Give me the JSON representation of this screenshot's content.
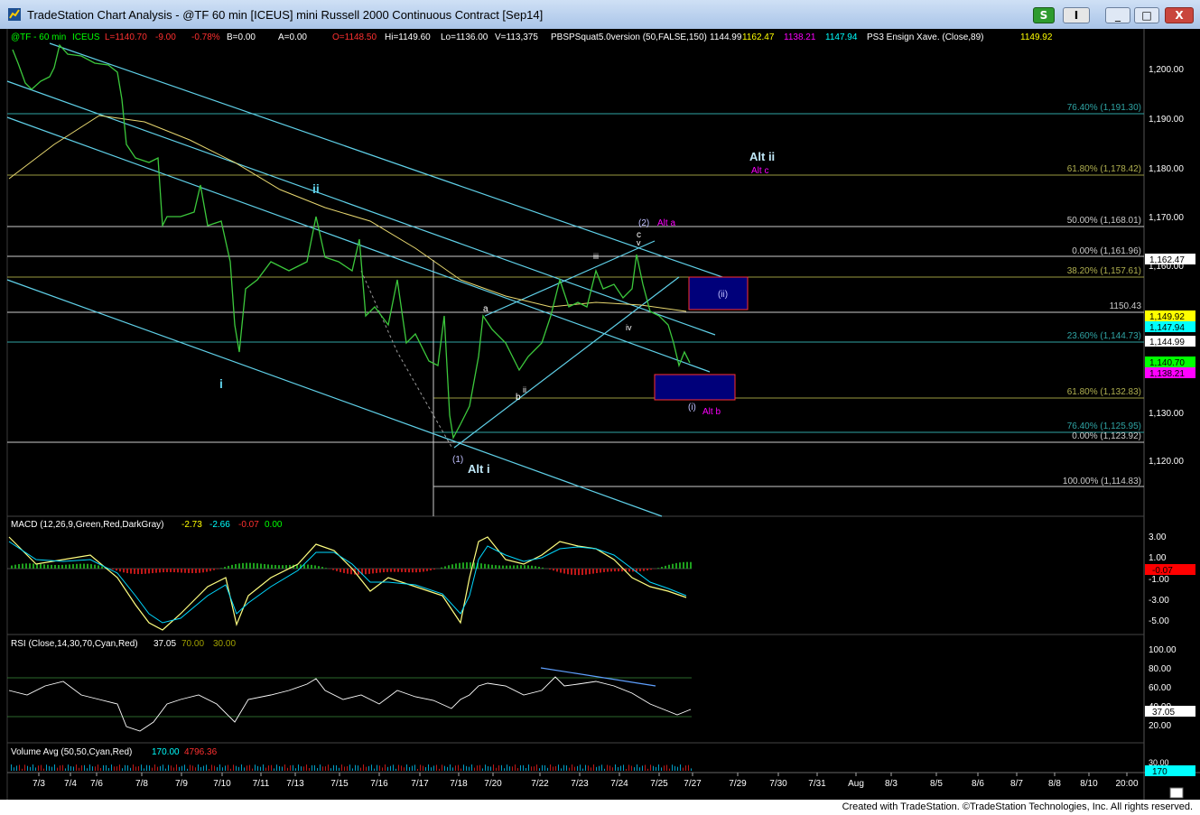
{
  "window": {
    "title": "TradeStation Chart Analysis - @TF 60 min [ICEUS] mini Russell 2000 Continuous Contract [Sep14]",
    "buttons": [
      "S",
      "I",
      "_",
      "□",
      "X"
    ]
  },
  "header": {
    "symbol": "@TF - 60 min",
    "exchange": "ICEUS",
    "last": "L=1140.70",
    "change": "-9.00",
    "pct": "-0.78%",
    "bid": "B=0.00",
    "ask": "A=0.00",
    "open": "O=1148.50",
    "hi": "Hi=1149.60",
    "lo": "Lo=1136.00",
    "vol": "V=113,375",
    "study": "PBSPSquat5.0version (50,FALSE,150)",
    "study_vals": [
      "1144.99",
      "1162.47",
      "1138.21",
      "1147.94"
    ],
    "ensign": "PS3 Ensign Xave. (Close,89)",
    "ensign_val": "1149.92"
  },
  "price_axis": {
    "ticks": [
      "1,200.00",
      "1,190.00",
      "1,180.00",
      "1,170.00",
      "1,160.00",
      "1,130.00",
      "1,120.00"
    ],
    "badges": [
      {
        "text": "1,162.47",
        "bg": "#ffffff",
        "fg": "#000000"
      },
      {
        "text": "1,149.92",
        "bg": "#ffff00",
        "fg": "#000000"
      },
      {
        "text": "1,147.94",
        "bg": "#00ffff",
        "fg": "#000000"
      },
      {
        "text": "1,144.99",
        "bg": "#ffffff",
        "fg": "#000000"
      },
      {
        "text": "1,140.70",
        "bg": "#00ff00",
        "fg": "#000000"
      },
      {
        "text": "1,138.21",
        "bg": "#ff00ff",
        "fg": "#000000"
      }
    ]
  },
  "fib_labels": [
    "76.40% (1,191.30)",
    "61.80% (1,178.42)",
    "50.00% (1,168.01)",
    "0.00% (1,161.96)",
    "38.20% (1,157.61)",
    "1150.43",
    "23.60% (1,144.73)",
    "61.80% (1,132.83)",
    "76.40% (1,125.95)",
    "0.00% (1,123.92)",
    "100.00% (1,114.83)"
  ],
  "annotations": {
    "i": "i",
    "ii": "ii",
    "alt_ii": "Alt ii",
    "alt_c": "Alt c",
    "two": "(2)",
    "alt_a": "Alt a",
    "c": "c",
    "v": "v",
    "iii": "iii",
    "a": "a",
    "iv": "iv",
    "b": "b",
    "ii_small": "ii",
    "box_ii": "(ii)",
    "box_i": "(i)",
    "alt_b": "Alt b",
    "one": "(1)",
    "alt_i": "Alt i"
  },
  "macd": {
    "label": "MACD (12,26,9,Green,Red,DarkGray)",
    "vals": [
      "-2.73",
      "-2.66",
      "-0.07",
      "0.00"
    ],
    "ticks": [
      "3.00",
      "1.00",
      "-1.00",
      "-3.00",
      "-5.00"
    ],
    "badge": "-0.07"
  },
  "rsi": {
    "label": "RSI (Close,14,30,70,Cyan,Red)",
    "vals": [
      "37.05",
      "70.00",
      "30.00"
    ],
    "ticks": [
      "100.00",
      "80.00",
      "60.00",
      "40.00",
      "20.00"
    ],
    "badge": "37.05"
  },
  "volume": {
    "label": "Volume Avg (50,50,Cyan,Red)",
    "vals": [
      "170.00",
      "4796.36"
    ],
    "badge": "170",
    "tick": "30.00"
  },
  "date_axis": [
    "7/3",
    "7/4",
    "7/6",
    "7/8",
    "7/9",
    "7/10",
    "7/11",
    "7/13",
    "7/15",
    "7/16",
    "7/17",
    "7/18",
    "7/20",
    "7/22",
    "7/23",
    "7/24",
    "7/25",
    "7/27",
    "7/29",
    "7/30",
    "7/31",
    "Aug",
    "8/3",
    "8/5",
    "8/6",
    "8/7",
    "8/8",
    "8/10",
    "20:00"
  ],
  "footer": "Created with TradeStation. ©TradeStation Technologies, Inc. All rights reserved."
}
